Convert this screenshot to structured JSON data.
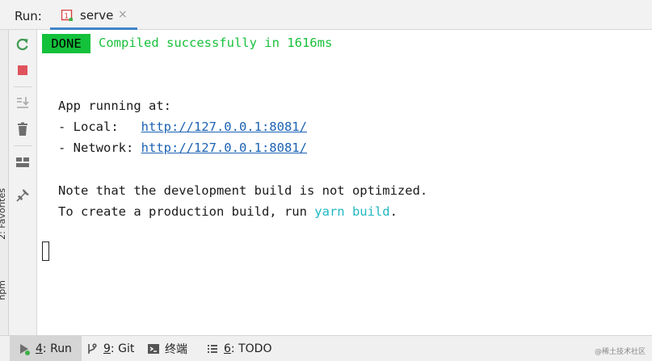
{
  "header": {
    "run_label": "Run:",
    "tab_label": "serve",
    "tab_close": "×"
  },
  "left_strip": {
    "favorites_label": "2: Favorites",
    "npm_label": "npm"
  },
  "toolbar": {
    "icons": [
      "rerun-icon",
      "stop-icon",
      "scroll-to-end-icon",
      "clear-icon",
      "layout-icon",
      "pin-icon"
    ]
  },
  "console": {
    "done_badge": "DONE",
    "compiled_message": "Compiled successfully in 1616ms",
    "app_running": "App running at:",
    "local_prefix": "- Local:   ",
    "local_url": "http://127.0.0.1:8081/",
    "network_prefix": "- Network: ",
    "network_url": "http://127.0.0.1:8081/",
    "note_line": "Note that the development build is not optimized.",
    "production_prefix": "To create a production build, run ",
    "production_command": "yarn build",
    "production_suffix": "."
  },
  "bottom_bar": {
    "run_hotkey": "4",
    "run_label": ": Run",
    "git_hotkey": "9",
    "git_label": ": Git",
    "terminal_label": "终端",
    "todo_hotkey": "6",
    "todo_label": ": TODO",
    "watermark": "@稀土技术社区"
  },
  "colors": {
    "done_bg": "#13c13b",
    "success_text": "#18c13c",
    "link": "#1c62b3",
    "command": "#20b8c2",
    "tab_underline": "#4083c9",
    "stop_red": "#e0535b",
    "rerun_green": "#3f9a52"
  }
}
